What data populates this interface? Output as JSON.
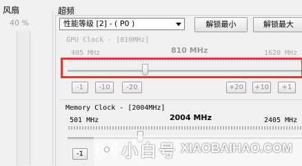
{
  "fan": {
    "title": "风扇",
    "percent": "40 %"
  },
  "overclock": {
    "title": "超频",
    "performance_level": "性能等级 [2] - ( P0 )",
    "unlock_min_label": "解锁最小",
    "unlock_max_label": "解锁最大",
    "gpu_clock": {
      "label": "GPU Clock - [810MHz]",
      "min": "405 MHz",
      "current": "810 MHz",
      "max": "1620 MHz",
      "level": 0.33,
      "steps_minus": [
        "-1",
        "-10",
        "-20"
      ],
      "steps_plus": [
        "+20",
        "+10",
        "+1"
      ]
    },
    "memory_clock": {
      "label": "Memory Clock - [2004MHz]",
      "min": "501 MHz",
      "current": "2004 MHz",
      "max": "2405 MHz",
      "level": 0.31,
      "step_minus_1": "-1"
    }
  },
  "watermark": {
    "brand_cn": "小白号",
    "brand_en": "XIAOBAIHAO.COM"
  },
  "colors": {
    "highlight_border": "#d63a3a",
    "window_bg": "#f0f0f0"
  }
}
